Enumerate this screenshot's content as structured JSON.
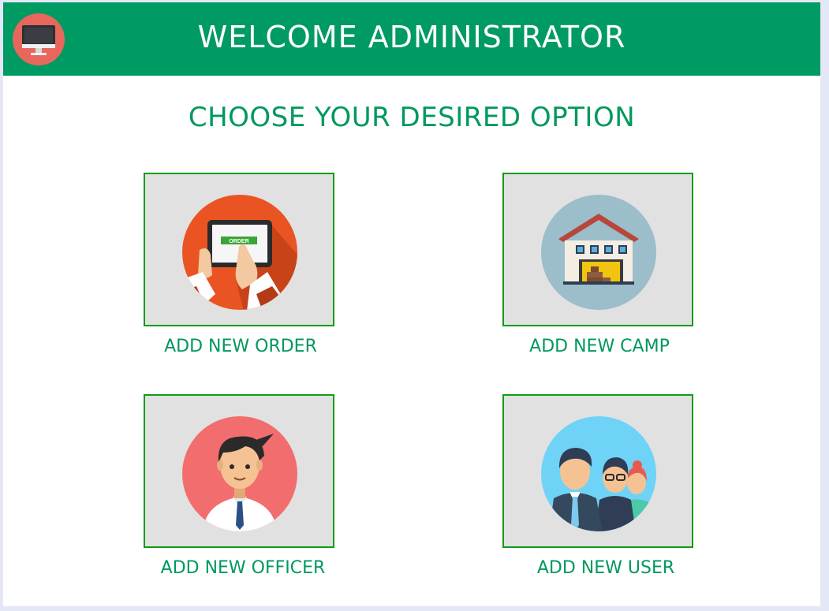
{
  "header": {
    "title": "WELCOME ADMINISTRATOR",
    "logo_icon": "monitor-icon",
    "background": "#009a63"
  },
  "main": {
    "heading": "CHOOSE YOUR DESIRED OPTION",
    "options": [
      {
        "label": "ADD NEW ORDER",
        "icon": "tablet-order-icon"
      },
      {
        "label": "ADD NEW CAMP",
        "icon": "warehouse-icon"
      },
      {
        "label": "ADD NEW OFFICER",
        "icon": "officer-avatar-icon"
      },
      {
        "label": "ADD NEW USER",
        "icon": "user-group-icon"
      }
    ]
  },
  "icon_texts": {
    "order_button": "ORDER"
  },
  "colors": {
    "accent": "#00995c",
    "card_border": "#119b17",
    "card_background": "#e1e1e1"
  }
}
